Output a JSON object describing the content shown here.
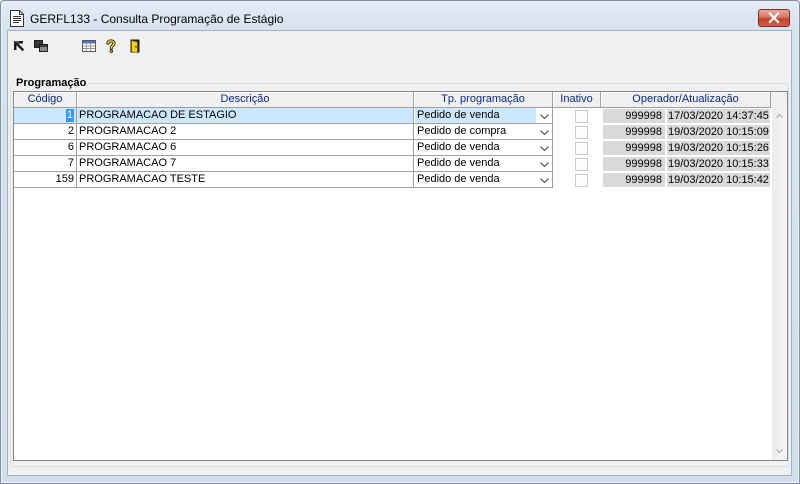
{
  "window": {
    "title": "GERFL133 - Consulta Programação de Estágio",
    "app_icon": "document-icon",
    "close_icon": "close-icon"
  },
  "toolbar": {
    "items": [
      {
        "icon": "arrow-icon"
      },
      {
        "icon": "windows-icon"
      },
      {
        "icon": "grid-icon"
      },
      {
        "icon": "help-icon"
      },
      {
        "icon": "exit-icon"
      }
    ]
  },
  "group": {
    "title": "Programação"
  },
  "table": {
    "columns": {
      "codigo": "Código",
      "descricao": "Descrição",
      "tipo": "Tp. programação",
      "inativo": "Inativo",
      "operador": "Operador/Atualização"
    },
    "selected_row": 0,
    "combo_icon": "chevron-down-icon",
    "rows": [
      {
        "codigo": "1",
        "descricao": "PROGRAMACAO DE ESTAGIO",
        "tipo": "Pedido de venda",
        "inativo": false,
        "operador": "999998",
        "atualizacao": "17/03/2020 14:37:45"
      },
      {
        "codigo": "2",
        "descricao": "PROGRAMACAO 2",
        "tipo": "Pedido de compra",
        "inativo": false,
        "operador": "999998",
        "atualizacao": "19/03/2020 10:15:09"
      },
      {
        "codigo": "6",
        "descricao": "PROGRAMACAO 6",
        "tipo": "Pedido de venda",
        "inativo": false,
        "operador": "999998",
        "atualizacao": "19/03/2020 10:15:26"
      },
      {
        "codigo": "7",
        "descricao": "PROGRAMACAO 7",
        "tipo": "Pedido de venda",
        "inativo": false,
        "operador": "999998",
        "atualizacao": "19/03/2020 10:15:33"
      },
      {
        "codigo": "159",
        "descricao": "PROGRAMACAO TESTE",
        "tipo": "Pedido de venda",
        "inativo": false,
        "operador": "999998",
        "atualizacao": "19/03/2020 10:15:42"
      }
    ]
  },
  "scrollbar": {
    "up_icon": "chevron-up-icon",
    "down_icon": "chevron-down-icon"
  },
  "colors": {
    "selection": "#cce8ff",
    "text_selection": "#3399ff",
    "header_text": "#0a2a8a",
    "readonly_cell": "#d9d9d9",
    "close_button": "#c7503c"
  }
}
